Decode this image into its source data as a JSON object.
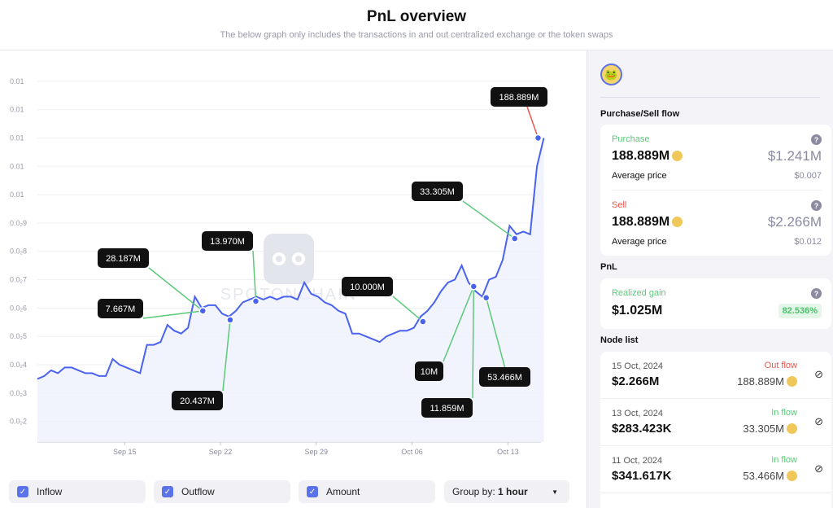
{
  "header": {
    "title": "PnL overview",
    "subtitle": "The below graph only includes the transactions in and out centralized exchange or the token swaps"
  },
  "watermark": "SPOTONCHAIN",
  "chart_data": {
    "type": "line",
    "title": "",
    "xlabel": "",
    "ylabel": "",
    "ylim": [
      0.00127,
      0.0148
    ],
    "xlim": [
      "2024-09-08T15:00",
      "2024-10-15T10:00"
    ],
    "grid": true,
    "colors": {
      "line": "#4a63ee",
      "fill": "#eef0fd",
      "inflow": "#5cc97a",
      "outflow": "#e8584e",
      "label_bg": "#111111"
    },
    "y_ticks": [
      {
        "v": 0.014,
        "label": "0.01"
      },
      {
        "v": 0.013,
        "label": "0.01"
      },
      {
        "v": 0.012,
        "label": "0.01"
      },
      {
        "v": 0.011,
        "label": "0.01"
      },
      {
        "v": 0.01,
        "label": "0.01"
      },
      {
        "v": 0.009,
        "label": "0.0₂9"
      },
      {
        "v": 0.008,
        "label": "0.0₂8"
      },
      {
        "v": 0.007,
        "label": "0.0₂7"
      },
      {
        "v": 0.006,
        "label": "0.0₂6"
      },
      {
        "v": 0.005,
        "label": "0.0₂5"
      },
      {
        "v": 0.004,
        "label": "0.0₂4"
      },
      {
        "v": 0.003,
        "label": "0.0₂3"
      },
      {
        "v": 0.002,
        "label": "0.0₂2"
      }
    ],
    "x_ticks": [
      {
        "d": "2024-09-15T00:00",
        "label": "Sep 15"
      },
      {
        "d": "2024-09-22T00:00",
        "label": "Sep 22"
      },
      {
        "d": "2024-09-29T00:00",
        "label": "Sep 29"
      },
      {
        "d": "2024-10-06T00:00",
        "label": "Oct 06"
      },
      {
        "d": "2024-10-13T00:00",
        "label": "Oct 13"
      }
    ],
    "series": [
      {
        "x_start": "2024-09-08T15:00",
        "step_hours": 12,
        "values": [
          0.0035,
          0.0036,
          0.0038,
          0.0037,
          0.0039,
          0.0039,
          0.0038,
          0.0037,
          0.0037,
          0.0036,
          0.0036,
          0.0042,
          0.004,
          0.0039,
          0.0038,
          0.0037,
          0.0047,
          0.0047,
          0.0048,
          0.0054,
          0.0052,
          0.0051,
          0.0053,
          0.0064,
          0.006,
          0.0061,
          0.0061,
          0.0058,
          0.0057,
          0.0059,
          0.0062,
          0.0063,
          0.0064,
          0.0063,
          0.0064,
          0.0063,
          0.0064,
          0.0064,
          0.0063,
          0.0069,
          0.0065,
          0.0064,
          0.0062,
          0.0061,
          0.0059,
          0.0058,
          0.0051,
          0.0051,
          0.005,
          0.0049,
          0.0048,
          0.005,
          0.0051,
          0.0052,
          0.0052,
          0.0053,
          0.0057,
          0.0059,
          0.0062,
          0.0066,
          0.0069,
          0.007,
          0.0075,
          0.0069,
          0.0066,
          0.0064,
          0.007,
          0.0071,
          0.0077,
          0.0089,
          0.0086,
          0.0087,
          0.0086,
          0.011,
          0.012
        ]
      }
    ],
    "annotations": [
      {
        "label": "28.187M",
        "date": "2024-09-20T17:00",
        "value": 0.0059,
        "flow": "in"
      },
      {
        "label": "7.667M",
        "date": "2024-09-20T17:00",
        "value": 0.0059,
        "flow": "in"
      },
      {
        "label": "20.437M",
        "date": "2024-09-22T17:00",
        "value": 0.00558,
        "flow": "in"
      },
      {
        "label": "13.970M",
        "date": "2024-09-24T14:00",
        "value": 0.00624,
        "flow": "in"
      },
      {
        "label": "10.000M",
        "date": "2024-10-06T19:00",
        "value": 0.00552,
        "flow": "in"
      },
      {
        "label": "10M",
        "date": "2024-10-10T12:00",
        "value": 0.00676,
        "flow": "in"
      },
      {
        "label": "11.859M",
        "date": "2024-10-10T12:00",
        "value": 0.00676,
        "flow": "in"
      },
      {
        "label": "53.466M",
        "date": "2024-10-11T10:00",
        "value": 0.00636,
        "flow": "in"
      },
      {
        "label": "33.305M",
        "date": "2024-10-13T12:00",
        "value": 0.00845,
        "flow": "in"
      },
      {
        "label": "188.889M",
        "date": "2024-10-15T05:00",
        "value": 0.012,
        "flow": "out"
      }
    ]
  },
  "controls": {
    "inflow": "Inflow",
    "outflow": "Outflow",
    "amount": "Amount",
    "group_by_label": "Group by:",
    "group_by_value": "1 hour"
  },
  "sidebar": {
    "flow_title": "Purchase/Sell flow",
    "purchase": {
      "label": "Purchase",
      "amount": "188.889M",
      "usd": "$1.241M",
      "avg_label": "Average price",
      "avg": "$0.007"
    },
    "sell": {
      "label": "Sell",
      "amount": "188.889M",
      "usd": "$2.266M",
      "avg_label": "Average price",
      "avg": "$0.012"
    },
    "pnl_title": "PnL",
    "pnl": {
      "label": "Realized gain",
      "value": "$1.025M",
      "percent": "82.536%"
    },
    "node_title": "Node list",
    "nodes": [
      {
        "date": "15 Oct, 2024",
        "usd": "$2.266M",
        "type": "Out flow",
        "amount": "188.889M"
      },
      {
        "date": "13 Oct, 2024",
        "usd": "$283.423K",
        "type": "In flow",
        "amount": "33.305M"
      },
      {
        "date": "11 Oct, 2024",
        "usd": "$341.617K",
        "type": "In flow",
        "amount": "53.466M"
      }
    ]
  }
}
